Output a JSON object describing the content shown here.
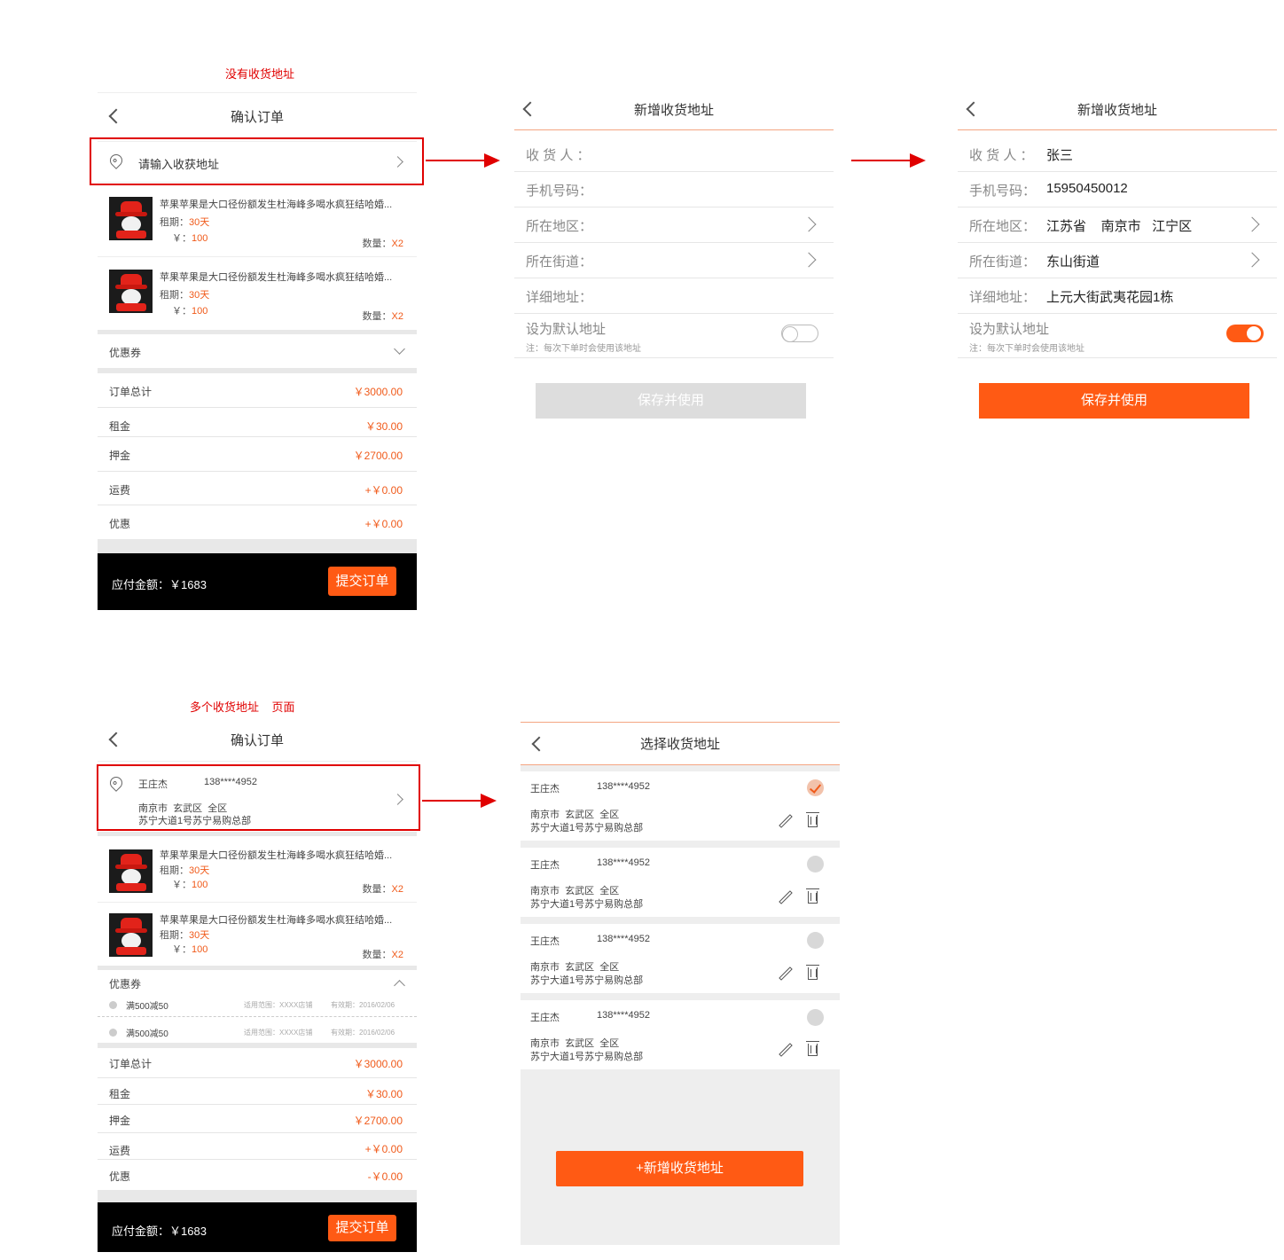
{
  "captions": {
    "no_address": "没有收货地址",
    "multi_address": "多个收货地址    页面"
  },
  "confirm_order": {
    "title": "确认订单",
    "address_placeholder": "请输入收获地址",
    "products": [
      {
        "title": "苹果苹果是大口径份额发生杜海峰多喝水疯狂结哈婚...",
        "rent_label": "租期：",
        "rent_value": "30天",
        "price_label": "￥：",
        "price_value": "100",
        "qty_label": "数量：",
        "qty_value": "X2"
      },
      {
        "title": "苹果苹果是大口径份额发生杜海峰多喝水疯狂结哈婚...",
        "rent_label": "租期：",
        "rent_value": "30天",
        "price_label": "￥：",
        "price_value": "100",
        "qty_label": "数量：",
        "qty_value": "X2"
      }
    ],
    "coupon_label": "优惠券",
    "summary": [
      {
        "label": "订单总计",
        "value": "￥3000.00"
      },
      {
        "label": "租金",
        "value": "￥30.00"
      },
      {
        "label": "押金",
        "value": "￥2700.00"
      },
      {
        "label": "运费",
        "value": "+￥0.00"
      },
      {
        "label": "优惠",
        "value": "+￥0.00"
      }
    ],
    "payable": "应付金额：￥1683",
    "submit": "提交订单"
  },
  "new_address_empty": {
    "title": "新增收货地址",
    "fields": [
      {
        "label": "收 货 人 ：",
        "value": ""
      },
      {
        "label": "手机号码：",
        "value": ""
      },
      {
        "label": "所在地区：",
        "value": ""
      },
      {
        "label": "所在街道：",
        "value": ""
      },
      {
        "label": "详细地址：",
        "value": ""
      }
    ],
    "default_label": "设为默认地址",
    "default_note": "注：每次下单时会使用该地址",
    "default_on": false,
    "save": "保存并使用"
  },
  "new_address_filled": {
    "title": "新增收货地址",
    "fields": [
      {
        "label": "收 货 人 ：",
        "value": "张三"
      },
      {
        "label": "手机号码：",
        "value": "15950450012"
      },
      {
        "label": "所在地区：",
        "value": "江苏省    南京市   江宁区"
      },
      {
        "label": "所在街道：",
        "value": "东山街道"
      },
      {
        "label": "详细地址：",
        "value": "上元大街武夷花园1栋"
      }
    ],
    "default_label": "设为默认地址",
    "default_note": "注：每次下单时会使用该地址",
    "default_on": true,
    "save": "保存并使用"
  },
  "confirm_order_multi": {
    "title": "确认订单",
    "address": {
      "name": "王庄杰",
      "phone": "138****4952",
      "region": "南京市  玄武区  全区",
      "street": "苏宁大道1号苏宁易购总部"
    },
    "products": [
      {
        "title": "苹果苹果是大口径份额发生杜海峰多喝水疯狂结哈婚...",
        "rent_label": "租期：",
        "rent_value": "30天",
        "price_label": "￥：",
        "price_value": "100",
        "qty_label": "数量：",
        "qty_value": "X2"
      },
      {
        "title": "苹果苹果是大口径份额发生杜海峰多喝水疯狂结哈婚...",
        "rent_label": "租期：",
        "rent_value": "30天",
        "price_label": "￥：",
        "price_value": "100",
        "qty_label": "数量：",
        "qty_value": "X2"
      }
    ],
    "coupon_label": "优惠券",
    "coupons": [
      {
        "name": "满500减50",
        "scope": "适用范围：XXXX店铺",
        "expiry": "有效期：2016/02/06"
      },
      {
        "name": "满500减50",
        "scope": "适用范围：XXXX店铺",
        "expiry": "有效期：2016/02/06"
      }
    ],
    "summary": [
      {
        "label": "订单总计",
        "value": "￥3000.00"
      },
      {
        "label": "租金",
        "value": "￥30.00"
      },
      {
        "label": "押金",
        "value": "￥2700.00"
      },
      {
        "label": "运费",
        "value": "+￥0.00"
      },
      {
        "label": "优惠",
        "value": "-￥0.00"
      }
    ],
    "payable": "应付金额：￥1683",
    "submit": "提交订单"
  },
  "select_address": {
    "title": "选择收货地址",
    "addresses": [
      {
        "name": "王庄杰",
        "phone": "138****4952",
        "region": "南京市  玄武区  全区",
        "street": "苏宁大道1号苏宁易购总部",
        "selected": true
      },
      {
        "name": "王庄杰",
        "phone": "138****4952",
        "region": "南京市  玄武区  全区",
        "street": "苏宁大道1号苏宁易购总部",
        "selected": false
      },
      {
        "name": "王庄杰",
        "phone": "138****4952",
        "region": "南京市  玄武区  全区",
        "street": "苏宁大道1号苏宁易购总部",
        "selected": false
      },
      {
        "name": "王庄杰",
        "phone": "138****4952",
        "region": "南京市  玄武区  全区",
        "street": "苏宁大道1号苏宁易购总部",
        "selected": false
      }
    ],
    "add_button": "+新增收货地址"
  },
  "colors": {
    "accent": "#ff5a14",
    "annotation_red": "#e00000",
    "disabled": "#dddddd"
  }
}
